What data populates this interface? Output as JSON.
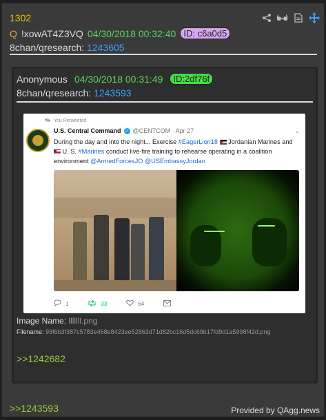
{
  "post": {
    "number": "1302",
    "q_marker": "Q",
    "tripcode": "!xowAT4Z3VQ",
    "date": "04/30/2018 00:32:40",
    "id": "ID: c6a0d5",
    "board": "8chan/qresearch:",
    "post_link": "1243605",
    "reply_link": ">>1243593",
    "credit": "Provided by QAgg.news"
  },
  "toolbar": {
    "icons": [
      "share-icon",
      "glasses-icon",
      "document-icon",
      "move-icon"
    ]
  },
  "quoted": {
    "name": "Anonymous",
    "date": "04/30/2018 00:31:49",
    "id": "ID:2df76f",
    "board": "8chan/qresearch:",
    "post_link": "1243593",
    "image_name_label": "Image Name:",
    "image_name": "lllllll.png",
    "filename_label": "Filename:",
    "filename": "99f6b3f387c5783e468e8423ee52863d71d82bc16d5dc69b17fd9d1a5998f42d.png",
    "reply_link": ">>1242682"
  },
  "tweet": {
    "retweet_label": "You Retweeted",
    "author_name": "U.S. Central Command",
    "handle_date": "@CENTCOM · Apr 27",
    "text_1": "During the day and into the night... Exercise ",
    "tag_1": "#EagerLion18",
    "text_2": " Jordanian Marines and ",
    "text_3": " U. S. ",
    "tag_2": "#Marines",
    "text_4": " conduct live-fire training to rehearse operating in a coalition environment ",
    "tag_3": "@ArmedForcesJO",
    "tag_4": "@USEmbassyJordan",
    "reply_count": "1",
    "retweet_count": "33",
    "like_count": "64"
  },
  "colors": {
    "post_number": "#f0c000",
    "date": "#5cd65c",
    "link": "#3fa0ff",
    "reply_link": "#9ccc3c",
    "id_badge_outer": "#d7a8f0",
    "id_badge_inner": "#44dd44"
  }
}
